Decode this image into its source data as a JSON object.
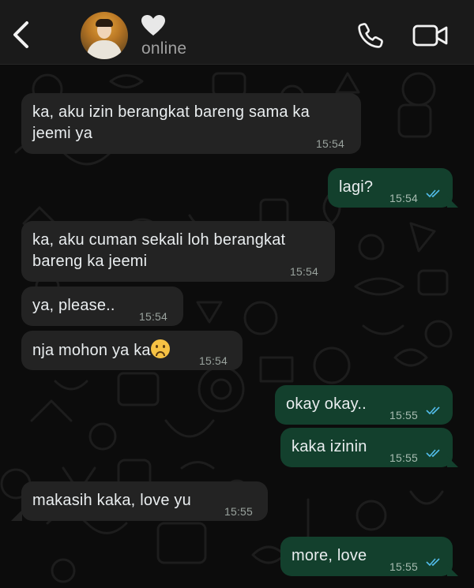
{
  "header": {
    "back_icon": "chevron-left-icon",
    "contact_name_icon": "white-heart-icon",
    "status": "online",
    "call_icon": "phone-icon",
    "video_icon": "video-camera-icon"
  },
  "colors": {
    "incoming_bubble": "#232323",
    "outgoing_bubble": "#13402d",
    "read_ticks": "#53bdeb",
    "header_bg": "#1a1a1a"
  },
  "messages": [
    {
      "direction": "in",
      "lines": [
        "ka, aku izin berangkat bareng sama ka",
        "jeemi ya"
      ],
      "time": "15:54"
    },
    {
      "direction": "out",
      "text": "lagi?",
      "time": "15:54",
      "read": true
    },
    {
      "direction": "in",
      "lines": [
        "ka, aku cuman sekali loh berangkat",
        "bareng ka jeemi"
      ],
      "time": "15:54"
    },
    {
      "direction": "in",
      "text": "ya, please..",
      "time": "15:54"
    },
    {
      "direction": "in",
      "text": "nja mohon ya ka",
      "emoji": "☹",
      "time": "15:54"
    },
    {
      "direction": "out",
      "text": "okay okay..",
      "time": "15:55",
      "read": true
    },
    {
      "direction": "out",
      "text": "kaka izinin",
      "time": "15:55",
      "read": true
    },
    {
      "direction": "in",
      "text": "makasih kaka, love yu",
      "time": "15:55"
    },
    {
      "direction": "out",
      "text": "more, love",
      "time": "15:55",
      "read": true
    }
  ]
}
